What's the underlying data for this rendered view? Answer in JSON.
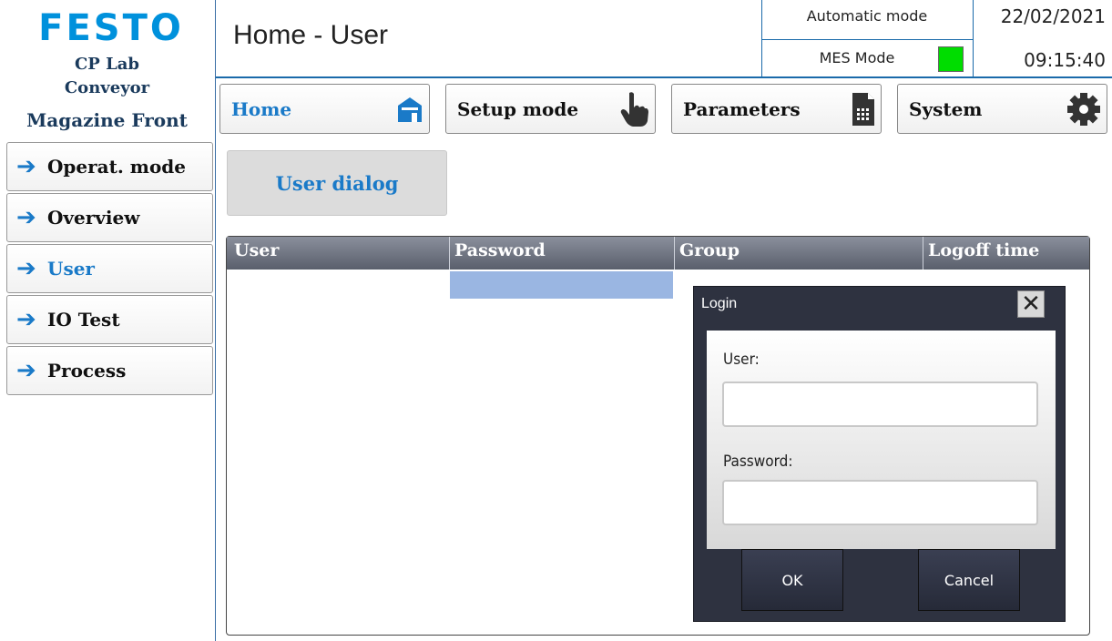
{
  "brand": {
    "logo_text": "FESTO",
    "line1": "CP Lab",
    "line2": "Conveyor",
    "line3": "Magazine Front"
  },
  "header": {
    "title": "Home - User",
    "mode": "Automatic mode",
    "mes_mode": "MES Mode",
    "mes_status_color": "#00dd00",
    "date": "22/02/2021",
    "time": "09:15:40"
  },
  "top_nav": [
    {
      "label": "Home",
      "icon": "house-icon"
    },
    {
      "label": "Setup mode",
      "icon": "hand-pointer-icon"
    },
    {
      "label": "Parameters",
      "icon": "document-icon"
    },
    {
      "label": "System",
      "icon": "gear-icon"
    }
  ],
  "side_nav": [
    {
      "label": "Operat. mode",
      "icon": "arrow-right-icon"
    },
    {
      "label": "Overview",
      "icon": "arrow-right-icon"
    },
    {
      "label": "User",
      "icon": "arrow-right-icon"
    },
    {
      "label": "IO Test",
      "icon": "arrow-right-icon"
    },
    {
      "label": "Process",
      "icon": "arrow-right-icon"
    }
  ],
  "main": {
    "user_dialog_label": "User dialog",
    "table": {
      "columns": [
        "User",
        "Password",
        "Group",
        "Logoff time"
      ]
    }
  },
  "login_dialog": {
    "title": "Login",
    "user_label": "User:",
    "user_value": "",
    "password_label": "Password:",
    "password_value": "",
    "ok_label": "OK",
    "cancel_label": "Cancel"
  },
  "colors": {
    "accent": "#1a7ac8",
    "festo_blue": "#0091dc",
    "brand_text": "#1a3a5c",
    "table_header": "#6b707d",
    "dialog_bg": "#2e3240"
  }
}
